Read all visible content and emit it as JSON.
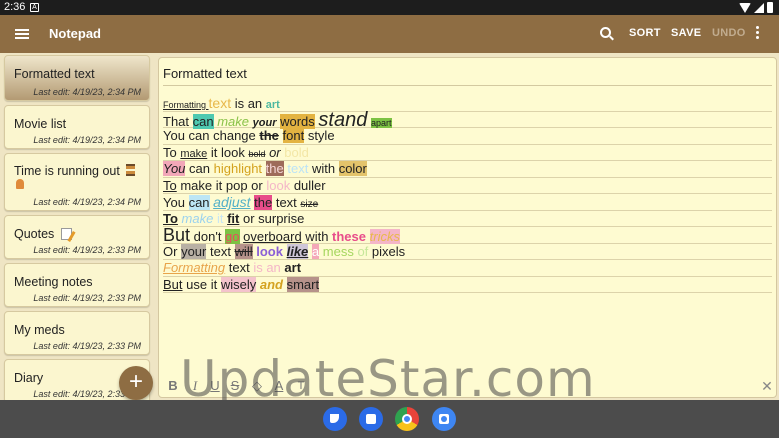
{
  "status_bar": {
    "time": "2:36",
    "notification_glyph": "A"
  },
  "app_bar": {
    "title": "Notepad",
    "actions": {
      "sort": "SORT",
      "save": "SAVE",
      "undo": "UNDO"
    },
    "undo_color": "#C1AC8F",
    "brand_color": "#8E6D43"
  },
  "notes": [
    {
      "title": "Formatted text",
      "date": "Last edit: 4/19/23, 2:34 PM",
      "active": true
    },
    {
      "title": "Movie list",
      "date": "Last edit: 4/19/23, 2:34 PM"
    },
    {
      "title": "Time is running out",
      "date": "Last edit: 4/19/23, 2:34 PM",
      "icons": [
        "hourglass-icon",
        "runner-icon"
      ]
    },
    {
      "title": "Quotes",
      "date": "Last edit: 4/19/23, 2:33 PM",
      "icons": [
        "memo-icon"
      ]
    },
    {
      "title": "Meeting notes",
      "date": "Last edit: 4/19/23, 2:33 PM"
    },
    {
      "title": "My meds",
      "date": "Last edit: 4/19/23, 2:33 PM"
    },
    {
      "title": "Diary",
      "date": "Last edit: 4/19/23, 2:33 PM"
    }
  ],
  "fab": {
    "label": "+"
  },
  "editor": {
    "title": "Formatted text",
    "lines": [
      [
        {
          "t": "Formatting ",
          "style": "font-size:9px;text-decoration:underline"
        },
        {
          "t": "text",
          "style": "color:#E8B84B;font-size:14px"
        },
        {
          "t": " is an "
        },
        {
          "t": "art",
          "style": "color:#4CB8A0;font-weight:bold;font-size:11px"
        }
      ],
      [
        {
          "t": "That "
        },
        {
          "t": "can",
          "style": "background:#4EC9B0"
        },
        {
          "t": " "
        },
        {
          "t": "make",
          "style": "color:#8BC34A;font-style:italic"
        },
        {
          "t": " "
        },
        {
          "t": "your",
          "style": "font-weight:bold;font-style:italic;font-size:11px"
        },
        {
          "t": " "
        },
        {
          "t": "words",
          "style": "background:#E3B341"
        },
        {
          "t": " "
        },
        {
          "t": "stand",
          "style": "font-size:20px;font-style:italic"
        },
        {
          "t": " "
        },
        {
          "t": "apart",
          "style": "background:#7CC243;font-size:9px"
        }
      ],
      [
        {
          "t": "You can change "
        },
        {
          "t": "the",
          "style": "text-decoration:line-through;font-weight:bold"
        },
        {
          "t": " "
        },
        {
          "t": "font",
          "style": "background:#E3B341"
        },
        {
          "t": " style"
        }
      ],
      [
        {
          "t": "To "
        },
        {
          "t": "make",
          "style": "text-decoration:underline;font-size:11px"
        },
        {
          "t": " it look "
        },
        {
          "t": "bold",
          "style": "text-decoration:line-through;font-size:9px"
        },
        {
          "t": " or ",
          "style": "font-style:italic"
        },
        {
          "t": "bold",
          "style": "color:#F3E7A6"
        }
      ],
      [
        {
          "t": "You",
          "style": "background:#F2A7B8;font-style:italic"
        },
        {
          "t": " can "
        },
        {
          "t": "highlight",
          "style": "color:#D4A21F"
        },
        {
          "t": " "
        },
        {
          "t": "the",
          "style": "background:#9E6B5A;color:#F6D7D7"
        },
        {
          "t": " "
        },
        {
          "t": "text",
          "style": "color:#BCE3F6"
        },
        {
          "t": " with "
        },
        {
          "t": "color",
          "style": "background:#E3C36B"
        }
      ],
      [
        {
          "t": "To",
          "style": "text-decoration:underline"
        },
        {
          "t": " make it pop or "
        },
        {
          "t": "look",
          "style": "color:#F4B6C8"
        },
        {
          "t": " duller"
        }
      ],
      [
        {
          "t": "You "
        },
        {
          "t": "can",
          "style": "background:#BDE6F5"
        },
        {
          "t": " "
        },
        {
          "t": "adjust",
          "style": "color:#52B0C8;font-style:italic;text-decoration:underline;font-size:14px"
        },
        {
          "t": " "
        },
        {
          "t": "the",
          "style": "background:#E84D8A"
        },
        {
          "t": " text "
        },
        {
          "t": "size",
          "style": "text-decoration:line-through;font-size:10px"
        }
      ],
      [
        {
          "t": "To",
          "style": "font-weight:bold;text-decoration:underline"
        },
        {
          "t": " "
        },
        {
          "t": "make",
          "style": "color:#9BD2EE;font-style:italic"
        },
        {
          "t": " it ",
          "style": "color:#C8E6F4"
        },
        {
          "t": "fit",
          "style": "font-weight:bold;text-decoration:underline"
        },
        {
          "t": " or surprise"
        }
      ],
      [
        {
          "t": "But",
          "style": "font-size:18px"
        },
        {
          "t": " don't "
        },
        {
          "t": "go",
          "style": "background:#7CC243;color:#E84D5C"
        },
        {
          "t": " "
        },
        {
          "t": "overboard",
          "style": "text-decoration:underline"
        },
        {
          "t": " with "
        },
        {
          "t": "these",
          "style": "color:#E84D8A;font-weight:bold"
        },
        {
          "t": " "
        },
        {
          "t": "tricks",
          "style": "background:#F4B6C8;color:#E8B84B;font-style:italic"
        }
      ],
      [
        {
          "t": "Or "
        },
        {
          "t": "your",
          "style": "background:#B8B0A4"
        },
        {
          "t": " text "
        },
        {
          "t": "will",
          "style": "background:#B6928A;text-decoration:line-through"
        },
        {
          "t": " "
        },
        {
          "t": "look",
          "style": "color:#8B5FD6;font-weight:bold"
        },
        {
          "t": " "
        },
        {
          "t": "like",
          "style": "background:#CFC6D8;font-weight:bold;font-style:italic;text-decoration:underline"
        },
        {
          "t": " "
        },
        {
          "t": "a",
          "style": "background:#F4A8B8;color:#fff"
        },
        {
          "t": " "
        },
        {
          "t": "mess",
          "style": "color:#A4D65E"
        },
        {
          "t": " "
        },
        {
          "t": "of",
          "style": "color:#C6E79A"
        },
        {
          "t": " pixels"
        }
      ],
      [
        {
          "t": "Formatting",
          "style": "color:#E8A44B;font-style:italic;text-decoration:underline"
        },
        {
          "t": " text "
        },
        {
          "t": "is an",
          "style": "color:#F4B6C8"
        },
        {
          "t": " "
        },
        {
          "t": "art",
          "style": "font-weight:bold"
        }
      ],
      [
        {
          "t": "But",
          "style": "text-decoration:underline"
        },
        {
          "t": " use it "
        },
        {
          "t": "wisely",
          "style": "background:#F4C3CC"
        },
        {
          "t": " "
        },
        {
          "t": "and",
          "style": "color:#D4A21F;font-weight:bold;font-style:italic"
        },
        {
          "t": " "
        },
        {
          "t": "smart",
          "style": "background:#B6928A"
        }
      ]
    ],
    "format_bar": {
      "bold": "B",
      "italic": "I",
      "underline": "U",
      "strike": "S",
      "color": "A",
      "clear": "T",
      "close": "✕"
    }
  },
  "watermark": "UpdateStar.com",
  "dock": [
    "phone-icon",
    "messages-icon",
    "chrome-icon",
    "camera-icon"
  ]
}
